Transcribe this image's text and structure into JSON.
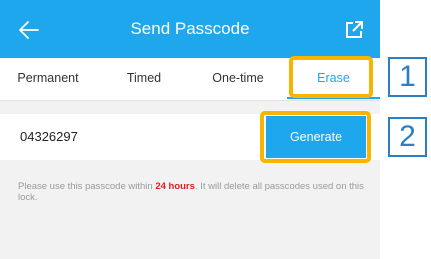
{
  "header": {
    "title": "Send Passcode",
    "back_icon": "arrow-left-icon",
    "share_icon": "external-share-icon",
    "color": "#1ea7ec"
  },
  "tabs": [
    {
      "label": "Permanent",
      "active": false
    },
    {
      "label": "Timed",
      "active": false
    },
    {
      "label": "One-time",
      "active": false
    },
    {
      "label": "Erase",
      "active": true
    }
  ],
  "passcode": {
    "value": "04326297",
    "generate_label": "Generate"
  },
  "notice": {
    "before": "Please use this passcode within ",
    "highlight": "24 hours",
    "after": ". It will delete all passcodes used on this lock."
  },
  "annotations": {
    "callout_1": "1",
    "callout_2": "2",
    "highlight_color": "#f7b500",
    "callout_color": "#2c7fc1"
  }
}
